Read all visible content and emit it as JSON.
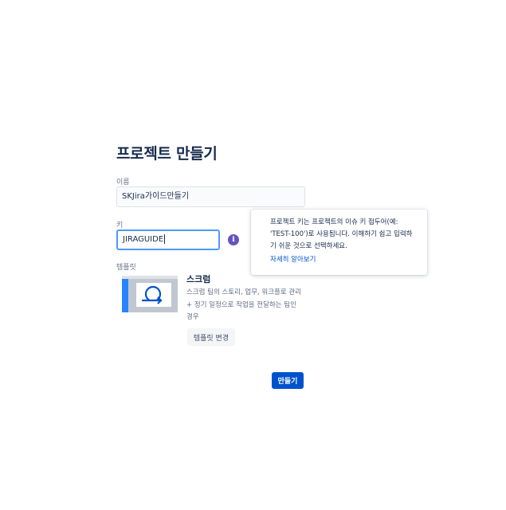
{
  "page": {
    "title": "프로젝트 만들기"
  },
  "form": {
    "name_label": "이름",
    "name_value": "SKJira가이드만들기",
    "key_label": "키",
    "key_value": "JIRAGUIDE",
    "template_label": "템플릿"
  },
  "info_popup": {
    "icon": "info-icon",
    "text": "프로젝트 키는 프로젝트의 이슈 키 접두어(예: 'TEST-100')로 사용됩니다. 이해하기 쉽고 입력하기 쉬운 것으로 선택하세요.",
    "link": "자세히 알아보기"
  },
  "template": {
    "name": "스크럼",
    "description": "스크럼 팀의 스토리, 업무, 워크플로 관리 + 정기 일정으로 작업을 전달하는 팀인 경우",
    "change_button": "템플릿 변경"
  },
  "actions": {
    "create_button": "만들기"
  },
  "colors": {
    "primary": "#0052cc",
    "focus_border": "#4c9aff",
    "info_icon": "#6554c0",
    "template_accent": "#2684ff"
  }
}
